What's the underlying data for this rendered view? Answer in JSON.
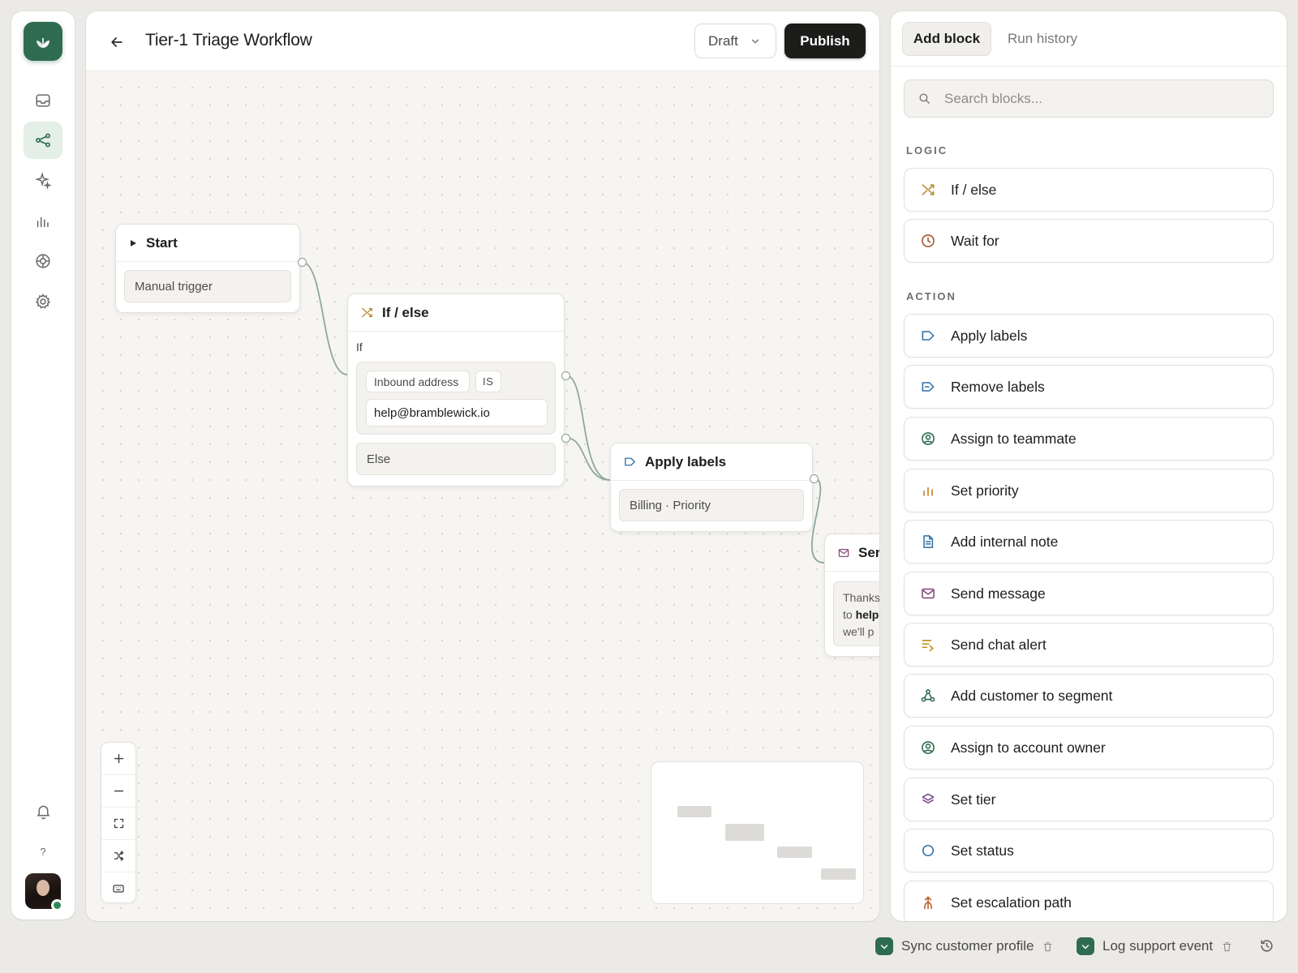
{
  "rail": {
    "nav": [
      {
        "name": "inbox-icon"
      },
      {
        "name": "workflow-icon",
        "active": true
      },
      {
        "name": "sparkle-icon"
      },
      {
        "name": "chart-icon"
      },
      {
        "name": "target-icon"
      },
      {
        "name": "gear-icon"
      }
    ],
    "help_label": "?"
  },
  "header": {
    "title": "Tier-1 Triage Workflow",
    "status_value": "Draft",
    "publish_label": "Publish"
  },
  "canvas": {
    "start_node": {
      "title": "Start",
      "trigger": "Manual trigger"
    },
    "ifelse_node": {
      "title": "If / else",
      "if_label": "If",
      "condition_field": "Inbound address",
      "condition_op": "IS",
      "condition_value": "help@bramblewick.io",
      "else_label": "Else"
    },
    "labels_node": {
      "title": "Apply labels",
      "labels": "Billing · Priority"
    },
    "send_node": {
      "title_partial": "Ser",
      "body_line1": "Thanks",
      "body_line2_prefix": "to ",
      "body_line2_bold": "help",
      "body_line3": "we'll p"
    }
  },
  "panel": {
    "tabs": {
      "active": "Add block",
      "other": "Run history"
    },
    "search_placeholder": "Search blocks...",
    "sections": [
      {
        "label": "LOGIC",
        "items": [
          {
            "label": "If / else",
            "icon": "shuffle-icon",
            "color": "#b8892b"
          },
          {
            "label": "Wait for",
            "icon": "clock-icon",
            "color": "#a0522d"
          }
        ]
      },
      {
        "label": "ACTION",
        "items": [
          {
            "label": "Apply labels",
            "icon": "tag-icon",
            "color": "#2f6fa8"
          },
          {
            "label": "Remove labels",
            "icon": "tag-remove-icon",
            "color": "#2f6fa8"
          },
          {
            "label": "Assign to teammate",
            "icon": "user-circle-icon",
            "color": "#2e6b4d"
          },
          {
            "label": "Set priority",
            "icon": "bars-icon",
            "color": "#c8802b"
          },
          {
            "label": "Add internal note",
            "icon": "document-icon",
            "color": "#2f6fa8"
          },
          {
            "label": "Send message",
            "icon": "mail-icon",
            "color": "#8a4b7a"
          },
          {
            "label": "Send chat alert",
            "icon": "chat-alert-icon",
            "color": "#c29324"
          },
          {
            "label": "Add customer to segment",
            "icon": "segment-icon",
            "color": "#2e6b4d"
          },
          {
            "label": "Assign to account owner",
            "icon": "user-circle-icon",
            "color": "#2e6b4d"
          },
          {
            "label": "Set tier",
            "icon": "layers-icon",
            "color": "#7a4a8a"
          },
          {
            "label": "Set status",
            "icon": "circle-icon",
            "color": "#2f6fa8"
          },
          {
            "label": "Set escalation path",
            "icon": "escalation-icon",
            "color": "#b5622b"
          }
        ]
      }
    ]
  },
  "footer": {
    "items": [
      {
        "label": "Sync customer profile"
      },
      {
        "label": "Log support event"
      }
    ]
  },
  "colors": {
    "brand": "#2f6b4f",
    "connector": "#8fa89a",
    "publish_bg": "#1c1c1b"
  }
}
